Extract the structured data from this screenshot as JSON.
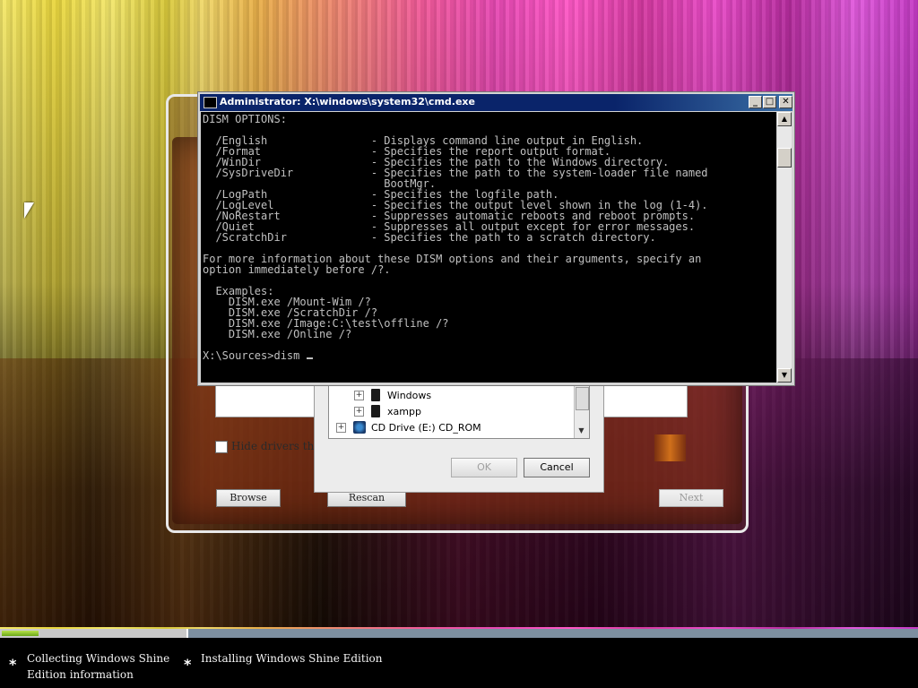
{
  "cmd_window": {
    "title": "Administrator: X:\\windows\\system32\\cmd.exe",
    "minimize": "_",
    "maximize": "□",
    "close": "✕",
    "console_text": "DISM OPTIONS:\n\n  /English                - Displays command line output in English.\n  /Format                 - Specifies the report output format.\n  /WinDir                 - Specifies the path to the Windows directory.\n  /SysDriveDir            - Specifies the path to the system-loader file named\n                            BootMgr.\n  /LogPath                - Specifies the logfile path.\n  /LogLevel               - Specifies the output level shown in the log (1-4).\n  /NoRestart              - Suppresses automatic reboots and reboot prompts.\n  /Quiet                  - Suppresses all output except for error messages.\n  /ScratchDir             - Specifies the path to a scratch directory.\n\nFor more information about these DISM options and their arguments, specify an\noption immediately before /?.\n\n  Examples:\n    DISM.exe /Mount-Wim /?\n    DISM.exe /ScratchDir /?\n    DISM.exe /Image:C:\\test\\offline /?\n    DISM.exe /Online /?\n\n",
    "prompt": "X:\\Sources>dism "
  },
  "folder_dialog": {
    "tree_items": [
      {
        "label": "Windows"
      },
      {
        "label": "xampp"
      },
      {
        "label": "CD Drive (E:) CD_ROM"
      }
    ],
    "ok_label": "OK",
    "cancel_label": "Cancel"
  },
  "setup_window": {
    "hide_label": "Hide drivers that",
    "browse_label": "Browse",
    "rescan_label": "Rescan",
    "next_label": "Next"
  },
  "progress": {
    "fraction": 0.2
  },
  "steps": [
    {
      "line1": "Collecting Windows Shine",
      "line2": "Edition information"
    },
    {
      "line1": "Installing Windows Shine Edition",
      "line2": ""
    }
  ]
}
